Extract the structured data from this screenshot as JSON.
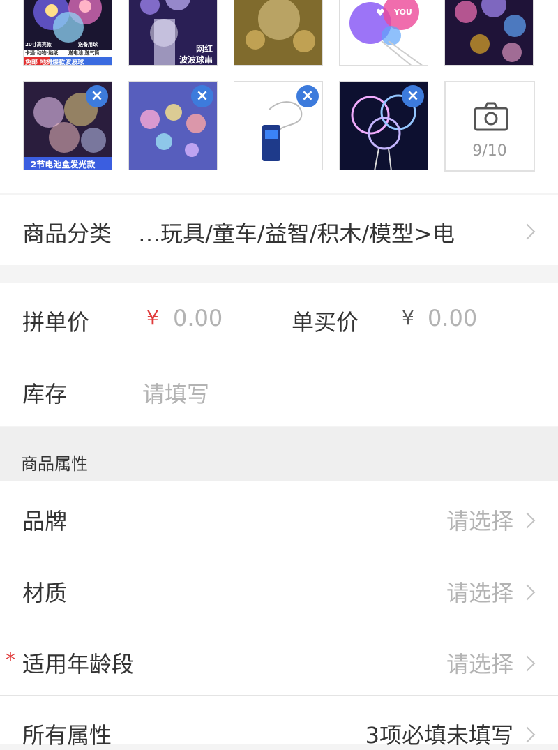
{
  "photos": {
    "items": [
      {
        "name": "photo-1",
        "caption_lines": [
          "20寸高亮款",
          "送备用球",
          "卡通·动物·贴纸",
          "送电池 送气筒",
          "免邮 地摊爆款波波球"
        ]
      },
      {
        "name": "photo-2",
        "caption_lines": [
          "网红",
          "波波球串"
        ]
      },
      {
        "name": "photo-3"
      },
      {
        "name": "photo-4",
        "caption_lines": [
          "♥",
          "YOU"
        ]
      },
      {
        "name": "photo-5"
      },
      {
        "name": "photo-6",
        "caption_lines": [
          "2节电池盒发光款"
        ]
      },
      {
        "name": "photo-7"
      },
      {
        "name": "photo-8"
      },
      {
        "name": "photo-9"
      }
    ],
    "delete_icon": "×",
    "add_counter": "9/10"
  },
  "category": {
    "label": "商品分类",
    "value": "…玩具/童车/益智/积木/模型>电"
  },
  "price": {
    "group_label": "拼单价",
    "group_currency": "¥",
    "group_value": "0.00",
    "single_label": "单买价",
    "single_currency": "¥",
    "single_value": "0.00"
  },
  "stock": {
    "label": "库存",
    "placeholder": "请填写"
  },
  "attributes": {
    "section_title": "商品属性",
    "rows": [
      {
        "label": "品牌",
        "value": "请选择",
        "required": false
      },
      {
        "label": "材质",
        "value": "请选择",
        "required": false
      },
      {
        "label": "适用年龄段",
        "value": "请选择",
        "required": true,
        "marker": "*"
      },
      {
        "label": "所有属性",
        "value": "3项必填未填写",
        "required": false
      }
    ]
  },
  "colors": {
    "accent_red": "#e03b3b",
    "delete_blue": "#3d7bdc",
    "placeholder_gray": "#b3b3b3"
  }
}
